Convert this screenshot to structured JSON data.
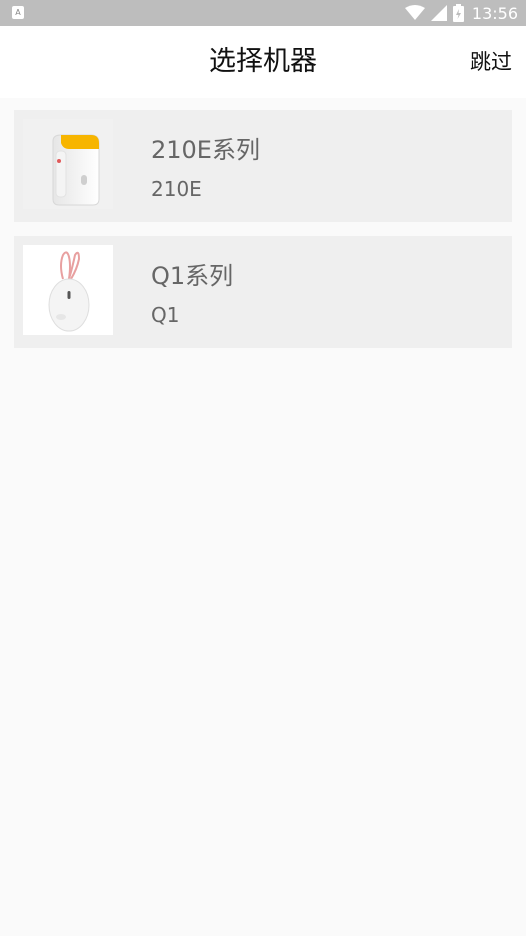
{
  "status_bar": {
    "time": "13:56",
    "left_icon": "A",
    "icons": [
      "wifi-icon",
      "signal-icon",
      "battery-icon"
    ]
  },
  "header": {
    "title": "选择机器",
    "skip_label": "跳过"
  },
  "devices": [
    {
      "series": "210E系列",
      "model": "210E",
      "image": "label-printer-210e"
    },
    {
      "series": "Q1系列",
      "model": "Q1",
      "image": "egg-printer-q1"
    }
  ],
  "colors": {
    "status_bar": "#bdbdbd",
    "background": "#fafafa",
    "card": "#efefef",
    "accent_yellow": "#f7b500",
    "accent_pink": "#e8a0a0"
  }
}
